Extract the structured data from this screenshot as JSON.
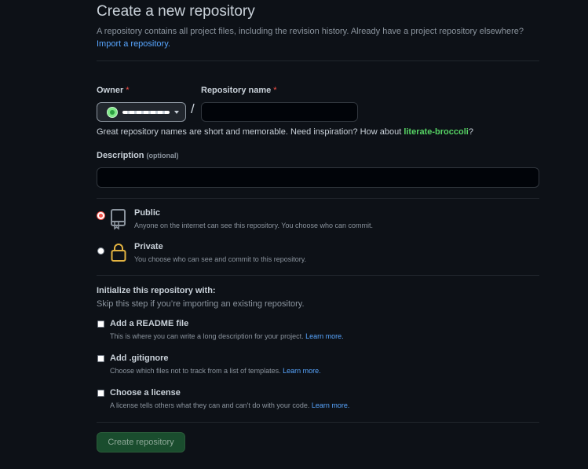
{
  "header": {
    "title": "Create a new repository",
    "subtitle": "A repository contains all project files, including the revision history. Already have a project repository elsewhere?",
    "import_link": "Import a repository."
  },
  "owner": {
    "label": "Owner",
    "required_mark": "*"
  },
  "repo_name": {
    "label": "Repository name",
    "required_mark": "*",
    "value": "",
    "slash": "/"
  },
  "suggestion": {
    "text": "Great repository names are short and memorable. Need inspiration? How about ",
    "name": "literate-broccoli",
    "suffix": "?"
  },
  "description": {
    "label": "Description",
    "optional": "(optional)",
    "value": ""
  },
  "visibility": {
    "public": {
      "title": "Public",
      "desc": "Anyone on the internet can see this repository. You choose who can commit.",
      "selected": true,
      "icon": "repo-icon"
    },
    "private": {
      "title": "Private",
      "desc": "You choose who can see and commit to this repository.",
      "selected": false,
      "icon": "lock-icon"
    }
  },
  "init": {
    "heading": "Initialize this repository with:",
    "sub": "Skip this step if you’re importing an existing repository.",
    "readme": {
      "title": "Add a README file",
      "desc": "This is where you can write a long description for your project.",
      "link": "Learn more."
    },
    "gitignore": {
      "title": "Add .gitignore",
      "desc": "Choose which files not to track from a list of templates.",
      "link": "Learn more."
    },
    "license": {
      "title": "Choose a license",
      "desc": "A license tells others what they can and can't do with your code.",
      "link": "Learn more."
    }
  },
  "submit": {
    "label": "Create repository"
  },
  "colors": {
    "background": "#0d1117",
    "accent_link": "#58a6ff",
    "suggestion_green": "#56d364",
    "required_red": "#f85149",
    "button_bg": "#1a4d2e"
  }
}
